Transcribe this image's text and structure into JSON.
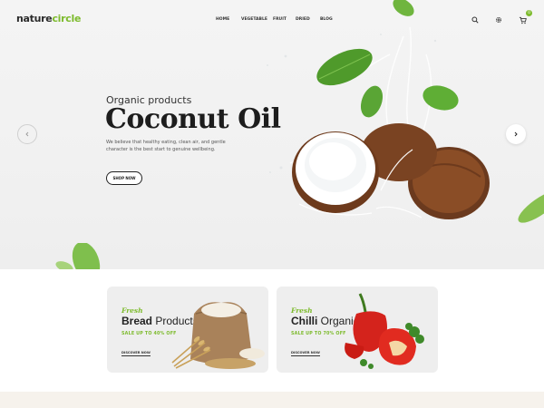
{
  "brand": {
    "logo_main": "nature",
    "logo_accent": "circle"
  },
  "nav": {
    "items": [
      "HOME",
      "VEGETABLE",
      "FRUIT",
      "DRIED",
      "BLOG"
    ]
  },
  "header_icons": [
    "search-icon",
    "settings-icon",
    "cart-icon"
  ],
  "cart": {
    "count": "0"
  },
  "slide": {
    "eyebrow": "Organic products",
    "title": "Coconut Oil",
    "description": "We believe that healthy eating, clean air, and gentle character is the best start to genuine wellbeing.",
    "cta": "SHOP NOW"
  },
  "banners": [
    {
      "eyebrow": "Fresh",
      "title_bold": "Bread",
      "title_rest": " Products",
      "sale": "SALE UP TO 40% OFF",
      "link": "DISCOVER NOW"
    },
    {
      "eyebrow": "Fresh",
      "title_bold": "Chilli",
      "title_rest": " Organic",
      "sale": "SALE UP TO 70% OFF",
      "link": "DISCOVER NOW"
    }
  ],
  "colors": {
    "accent": "#7dbb2d",
    "text": "#1d1d1d",
    "hero_bg": "#f2f2f2",
    "banner_bg": "#eeeeee"
  }
}
